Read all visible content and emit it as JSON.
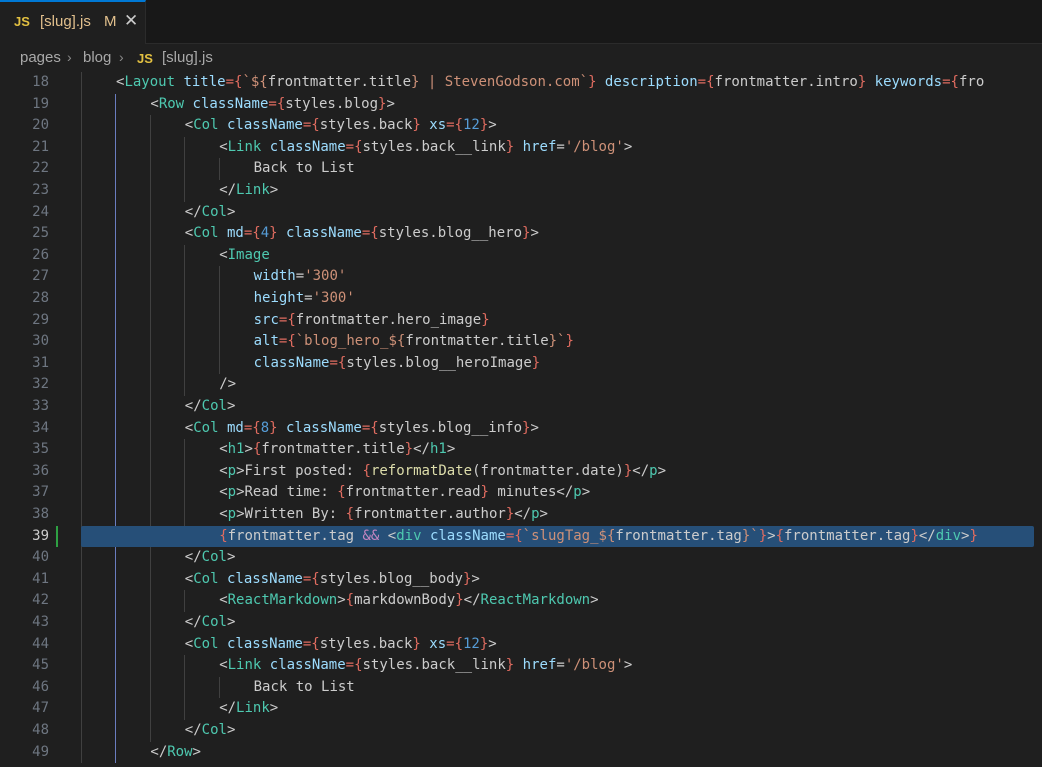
{
  "tab": {
    "icon": "JS",
    "filename": "[slug].js",
    "status": "M",
    "close": "✕"
  },
  "breadcrumb": {
    "items": [
      "pages",
      "blog",
      "[slug].js"
    ],
    "file_icon": "JS",
    "separator": "›"
  },
  "editor": {
    "current_line": 39,
    "lines": [
      {
        "n": "18",
        "indent": 2,
        "tokens": [
          [
            "<",
            "pl"
          ],
          [
            "Layout",
            "tag"
          ],
          [
            " title",
            "attr"
          ],
          [
            "={",
            "brace"
          ],
          [
            "`${",
            "str"
          ],
          [
            "frontmatter.title",
            "pl"
          ],
          [
            "}",
            "str"
          ],
          [
            " | StevenGodson.com`",
            "str"
          ],
          [
            "}",
            "brace"
          ],
          [
            " description",
            "attr"
          ],
          [
            "={",
            "brace"
          ],
          [
            "frontmatter.intro",
            "pl"
          ],
          [
            "}",
            "brace"
          ],
          [
            " keywords",
            "attr"
          ],
          [
            "={",
            "brace"
          ],
          [
            "fro",
            "pl"
          ]
        ]
      },
      {
        "n": "19",
        "indent": 3,
        "tokens": [
          [
            "<",
            "pl"
          ],
          [
            "Row",
            "tag"
          ],
          [
            " className",
            "attr"
          ],
          [
            "={",
            "brace"
          ],
          [
            "styles.blog",
            "pl"
          ],
          [
            "}",
            "brace"
          ],
          [
            ">",
            "pl"
          ]
        ]
      },
      {
        "n": "20",
        "indent": 4,
        "tokens": [
          [
            "<",
            "pl"
          ],
          [
            "Col",
            "tag"
          ],
          [
            " className",
            "attr"
          ],
          [
            "={",
            "brace"
          ],
          [
            "styles.back",
            "pl"
          ],
          [
            "}",
            "brace"
          ],
          [
            " xs",
            "attr"
          ],
          [
            "={",
            "brace"
          ],
          [
            "12",
            "kw"
          ],
          [
            "}",
            "brace"
          ],
          [
            ">",
            "pl"
          ]
        ]
      },
      {
        "n": "21",
        "indent": 5,
        "tokens": [
          [
            "<",
            "pl"
          ],
          [
            "Link",
            "tag"
          ],
          [
            " className",
            "attr"
          ],
          [
            "={",
            "brace"
          ],
          [
            "styles.back__link",
            "pl"
          ],
          [
            "}",
            "brace"
          ],
          [
            " href",
            "attr"
          ],
          [
            "=",
            "pl"
          ],
          [
            "'/blog'",
            "str"
          ],
          [
            ">",
            "pl"
          ]
        ]
      },
      {
        "n": "22",
        "indent": 6,
        "tokens": [
          [
            "Back to List",
            "pl"
          ]
        ]
      },
      {
        "n": "23",
        "indent": 5,
        "tokens": [
          [
            "</",
            "pl"
          ],
          [
            "Link",
            "tag"
          ],
          [
            ">",
            "pl"
          ]
        ]
      },
      {
        "n": "24",
        "indent": 4,
        "tokens": [
          [
            "</",
            "pl"
          ],
          [
            "Col",
            "tag"
          ],
          [
            ">",
            "pl"
          ]
        ]
      },
      {
        "n": "25",
        "indent": 4,
        "tokens": [
          [
            "<",
            "pl"
          ],
          [
            "Col",
            "tag"
          ],
          [
            " md",
            "attr"
          ],
          [
            "={",
            "brace"
          ],
          [
            "4",
            "kw"
          ],
          [
            "}",
            "brace"
          ],
          [
            " className",
            "attr"
          ],
          [
            "={",
            "brace"
          ],
          [
            "styles.blog__hero",
            "pl"
          ],
          [
            "}",
            "brace"
          ],
          [
            ">",
            "pl"
          ]
        ]
      },
      {
        "n": "26",
        "indent": 5,
        "tokens": [
          [
            "<",
            "pl"
          ],
          [
            "Image",
            "tag"
          ]
        ]
      },
      {
        "n": "27",
        "indent": 6,
        "tokens": [
          [
            "width",
            "attr"
          ],
          [
            "=",
            "pl"
          ],
          [
            "'300'",
            "str"
          ]
        ]
      },
      {
        "n": "28",
        "indent": 6,
        "tokens": [
          [
            "height",
            "attr"
          ],
          [
            "=",
            "pl"
          ],
          [
            "'300'",
            "str"
          ]
        ]
      },
      {
        "n": "29",
        "indent": 6,
        "tokens": [
          [
            "src",
            "attr"
          ],
          [
            "={",
            "brace"
          ],
          [
            "frontmatter.hero_image",
            "pl"
          ],
          [
            "}",
            "brace"
          ]
        ]
      },
      {
        "n": "30",
        "indent": 6,
        "tokens": [
          [
            "alt",
            "attr"
          ],
          [
            "={",
            "brace"
          ],
          [
            "`blog_hero_${",
            "str"
          ],
          [
            "frontmatter.title",
            "pl"
          ],
          [
            "}`",
            "str"
          ],
          [
            "}",
            "brace"
          ]
        ]
      },
      {
        "n": "31",
        "indent": 6,
        "tokens": [
          [
            "className",
            "attr"
          ],
          [
            "={",
            "brace"
          ],
          [
            "styles.blog__heroImage",
            "pl"
          ],
          [
            "}",
            "brace"
          ]
        ]
      },
      {
        "n": "32",
        "indent": 5,
        "tokens": [
          [
            "/>",
            "pl"
          ]
        ]
      },
      {
        "n": "33",
        "indent": 4,
        "tokens": [
          [
            "</",
            "pl"
          ],
          [
            "Col",
            "tag"
          ],
          [
            ">",
            "pl"
          ]
        ]
      },
      {
        "n": "34",
        "indent": 4,
        "tokens": [
          [
            "<",
            "pl"
          ],
          [
            "Col",
            "tag"
          ],
          [
            " md",
            "attr"
          ],
          [
            "={",
            "brace"
          ],
          [
            "8",
            "kw"
          ],
          [
            "}",
            "brace"
          ],
          [
            " className",
            "attr"
          ],
          [
            "={",
            "brace"
          ],
          [
            "styles.blog__info",
            "pl"
          ],
          [
            "}",
            "brace"
          ],
          [
            ">",
            "pl"
          ]
        ]
      },
      {
        "n": "35",
        "indent": 5,
        "tokens": [
          [
            "<",
            "pl"
          ],
          [
            "h1",
            "tag"
          ],
          [
            ">",
            "pl"
          ],
          [
            "{",
            "brace"
          ],
          [
            "frontmatter.title",
            "pl"
          ],
          [
            "}",
            "brace"
          ],
          [
            "</",
            "pl"
          ],
          [
            "h1",
            "tag"
          ],
          [
            ">",
            "pl"
          ]
        ]
      },
      {
        "n": "36",
        "indent": 5,
        "tokens": [
          [
            "<",
            "pl"
          ],
          [
            "p",
            "tag"
          ],
          [
            ">",
            "pl"
          ],
          [
            "First posted: ",
            "pl"
          ],
          [
            "{",
            "brace"
          ],
          [
            "reformatDate",
            "fn"
          ],
          [
            "(frontmatter.date)",
            "pl"
          ],
          [
            "}",
            "brace"
          ],
          [
            "</",
            "pl"
          ],
          [
            "p",
            "tag"
          ],
          [
            ">",
            "pl"
          ]
        ]
      },
      {
        "n": "37",
        "indent": 5,
        "tokens": [
          [
            "<",
            "pl"
          ],
          [
            "p",
            "tag"
          ],
          [
            ">",
            "pl"
          ],
          [
            "Read time: ",
            "pl"
          ],
          [
            "{",
            "brace"
          ],
          [
            "frontmatter.read",
            "pl"
          ],
          [
            "}",
            "brace"
          ],
          [
            " minutes",
            "pl"
          ],
          [
            "</",
            "pl"
          ],
          [
            "p",
            "tag"
          ],
          [
            ">",
            "pl"
          ]
        ]
      },
      {
        "n": "38",
        "indent": 5,
        "tokens": [
          [
            "<",
            "pl"
          ],
          [
            "p",
            "tag"
          ],
          [
            ">",
            "pl"
          ],
          [
            "Written By: ",
            "pl"
          ],
          [
            "{",
            "brace"
          ],
          [
            "frontmatter.author",
            "pl"
          ],
          [
            "}",
            "brace"
          ],
          [
            "</",
            "pl"
          ],
          [
            "p",
            "tag"
          ],
          [
            ">",
            "pl"
          ]
        ]
      },
      {
        "n": "39",
        "indent": 5,
        "tokens": [
          [
            "{",
            "brace"
          ],
          [
            "frontmatter.tag",
            "pl"
          ],
          [
            " && ",
            "op"
          ],
          [
            "<",
            "pl"
          ],
          [
            "div",
            "tag"
          ],
          [
            " className",
            "attr"
          ],
          [
            "={",
            "brace"
          ],
          [
            "`slugTag_${",
            "str"
          ],
          [
            "frontmatter.tag",
            "pl"
          ],
          [
            "}`",
            "str"
          ],
          [
            "}",
            "brace"
          ],
          [
            ">",
            "pl"
          ],
          [
            "{",
            "brace"
          ],
          [
            "frontmatter.tag",
            "pl"
          ],
          [
            "}",
            "brace"
          ],
          [
            "</",
            "pl"
          ],
          [
            "div",
            "tag"
          ],
          [
            ">",
            "pl"
          ],
          [
            "}",
            "brace"
          ]
        ]
      },
      {
        "n": "40",
        "indent": 4,
        "tokens": [
          [
            "</",
            "pl"
          ],
          [
            "Col",
            "tag"
          ],
          [
            ">",
            "pl"
          ]
        ]
      },
      {
        "n": "41",
        "indent": 4,
        "tokens": [
          [
            "<",
            "pl"
          ],
          [
            "Col",
            "tag"
          ],
          [
            " className",
            "attr"
          ],
          [
            "={",
            "brace"
          ],
          [
            "styles.blog__body",
            "pl"
          ],
          [
            "}",
            "brace"
          ],
          [
            ">",
            "pl"
          ]
        ]
      },
      {
        "n": "42",
        "indent": 5,
        "tokens": [
          [
            "<",
            "pl"
          ],
          [
            "ReactMarkdown",
            "tag"
          ],
          [
            ">",
            "pl"
          ],
          [
            "{",
            "brace"
          ],
          [
            "markdownBody",
            "pl"
          ],
          [
            "}",
            "brace"
          ],
          [
            "</",
            "pl"
          ],
          [
            "ReactMarkdown",
            "tag"
          ],
          [
            ">",
            "pl"
          ]
        ]
      },
      {
        "n": "43",
        "indent": 4,
        "tokens": [
          [
            "</",
            "pl"
          ],
          [
            "Col",
            "tag"
          ],
          [
            ">",
            "pl"
          ]
        ]
      },
      {
        "n": "44",
        "indent": 4,
        "tokens": [
          [
            "<",
            "pl"
          ],
          [
            "Col",
            "tag"
          ],
          [
            " className",
            "attr"
          ],
          [
            "={",
            "brace"
          ],
          [
            "styles.back",
            "pl"
          ],
          [
            "}",
            "brace"
          ],
          [
            " xs",
            "attr"
          ],
          [
            "={",
            "brace"
          ],
          [
            "12",
            "kw"
          ],
          [
            "}",
            "brace"
          ],
          [
            ">",
            "pl"
          ]
        ]
      },
      {
        "n": "45",
        "indent": 5,
        "tokens": [
          [
            "<",
            "pl"
          ],
          [
            "Link",
            "tag"
          ],
          [
            " className",
            "attr"
          ],
          [
            "={",
            "brace"
          ],
          [
            "styles.back__link",
            "pl"
          ],
          [
            "}",
            "brace"
          ],
          [
            " href",
            "attr"
          ],
          [
            "=",
            "pl"
          ],
          [
            "'/blog'",
            "str"
          ],
          [
            ">",
            "pl"
          ]
        ]
      },
      {
        "n": "46",
        "indent": 6,
        "tokens": [
          [
            "Back to List",
            "pl"
          ]
        ]
      },
      {
        "n": "47",
        "indent": 5,
        "tokens": [
          [
            "</",
            "pl"
          ],
          [
            "Link",
            "tag"
          ],
          [
            ">",
            "pl"
          ]
        ]
      },
      {
        "n": "48",
        "indent": 4,
        "tokens": [
          [
            "</",
            "pl"
          ],
          [
            "Col",
            "tag"
          ],
          [
            ">",
            "pl"
          ]
        ]
      },
      {
        "n": "49",
        "indent": 3,
        "tokens": [
          [
            "</",
            "pl"
          ],
          [
            "Row",
            "tag"
          ],
          [
            ">",
            "pl"
          ]
        ]
      }
    ]
  }
}
